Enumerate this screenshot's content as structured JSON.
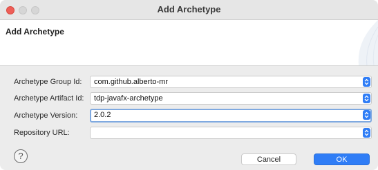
{
  "window": {
    "title": "Add Archetype"
  },
  "banner": {
    "title": "Add Archetype"
  },
  "form": {
    "fields": [
      {
        "label": "Archetype Group Id:",
        "value": "com.github.alberto-mr"
      },
      {
        "label": "Archetype Artifact Id:",
        "value": "tdp-javafx-archetype"
      },
      {
        "label": "Archetype Version:",
        "value": "2.0.2"
      },
      {
        "label": "Repository URL:",
        "value": ""
      }
    ]
  },
  "footer": {
    "help_glyph": "?",
    "cancel_label": "Cancel",
    "ok_label": "OK"
  },
  "colors": {
    "accent": "#2f7df6",
    "close_button": "#ee5e58",
    "focus_ring": "#7fa9e0"
  }
}
